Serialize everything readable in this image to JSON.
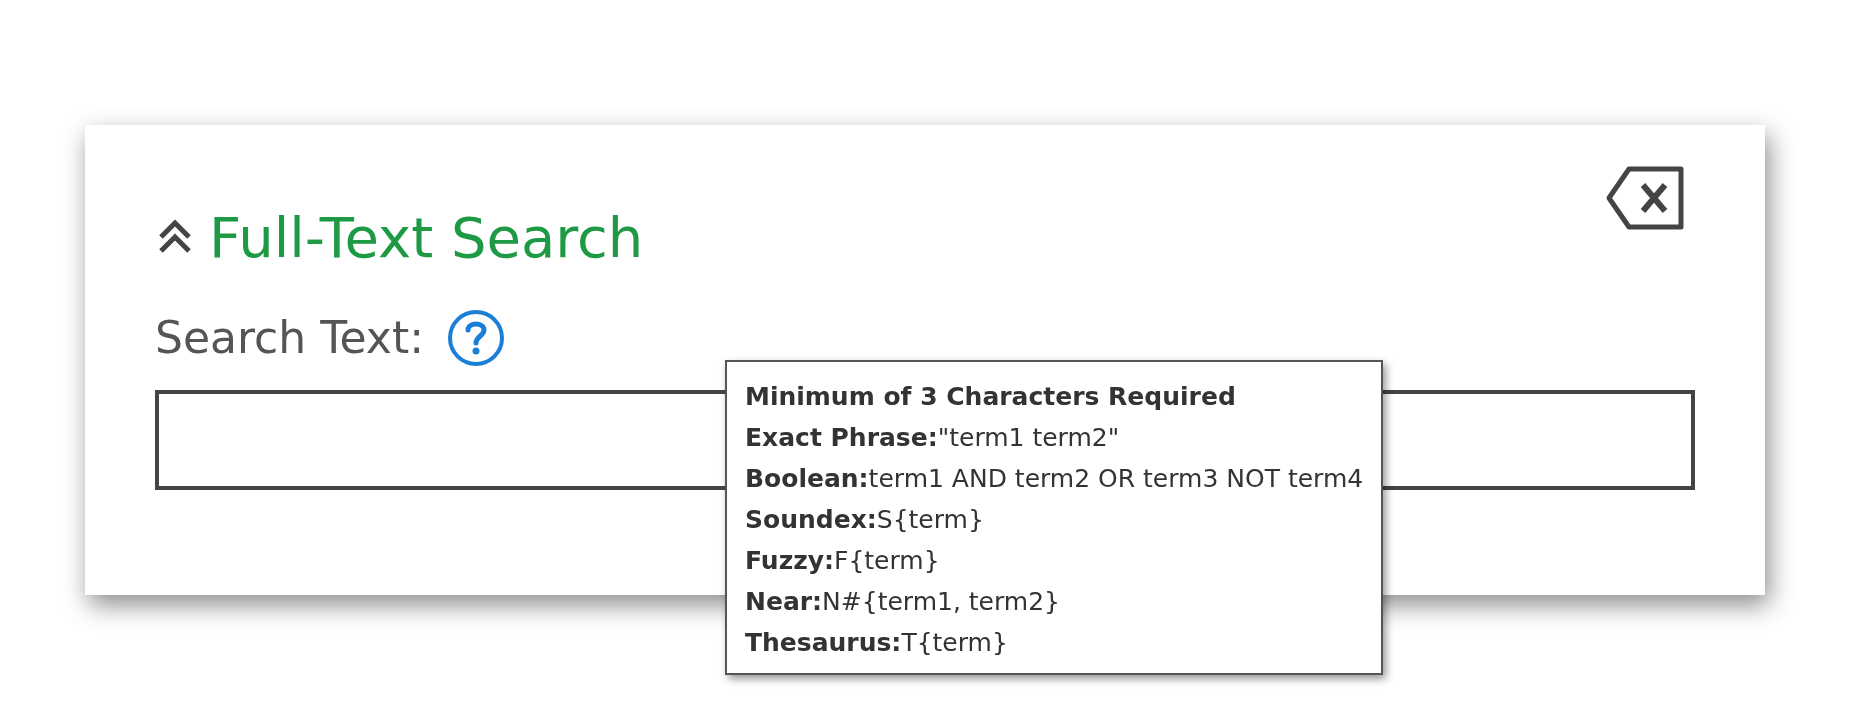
{
  "panel": {
    "title": "Full-Text Search",
    "expanded": true
  },
  "search": {
    "label": "Search Text:"
  },
  "tooltip": {
    "heading": "Minimum of 3 Characters Required",
    "lines": [
      "**Exact Phrase:**\"term1 term2\"",
      "**Boolean:**term1 AND term2 OR term3 NOT term4",
      "**Soundex:**S{term}",
      "**Fuzzy:**F{term}",
      "**Near:**N#{term1, term2}",
      "**Thesaurus:**T{term}"
    ]
  }
}
